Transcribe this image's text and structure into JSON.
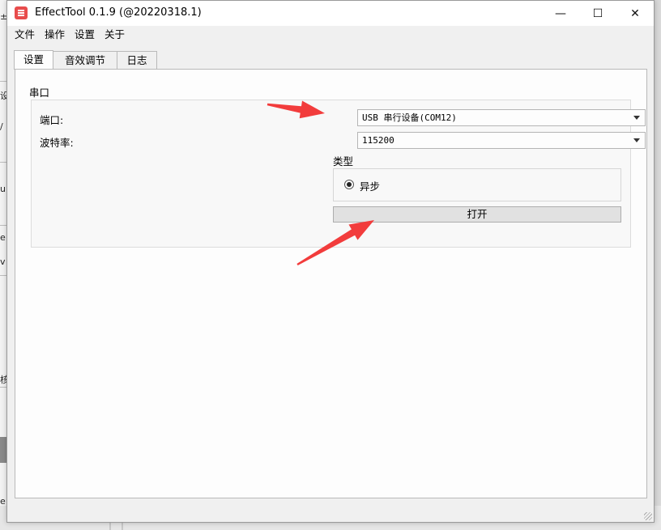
{
  "background": {
    "fragments": [
      "±",
      "设",
      "/",
      "up",
      "e",
      "v",
      "核",
      "e"
    ]
  },
  "window": {
    "title": "EffectTool 0.1.9  (@20220318.1)",
    "controls": {
      "minimize": "—",
      "maximize": "☐",
      "close": "✕"
    }
  },
  "menu": [
    "文件",
    "操作",
    "设置",
    "关于"
  ],
  "tabs": [
    "设置",
    "音效调节",
    "日志"
  ],
  "active_tab": "设置",
  "serial": {
    "group_title": "串口",
    "port_label": "端口:",
    "port_value": "USB 串行设备(COM12)",
    "baud_label": "波特率:",
    "baud_value": "115200",
    "type_label": "类型",
    "type_option": "异步",
    "open_button": "打开"
  },
  "colors": {
    "annotation_arrow": "#f23c3c",
    "app_icon": "#e84c4c"
  }
}
